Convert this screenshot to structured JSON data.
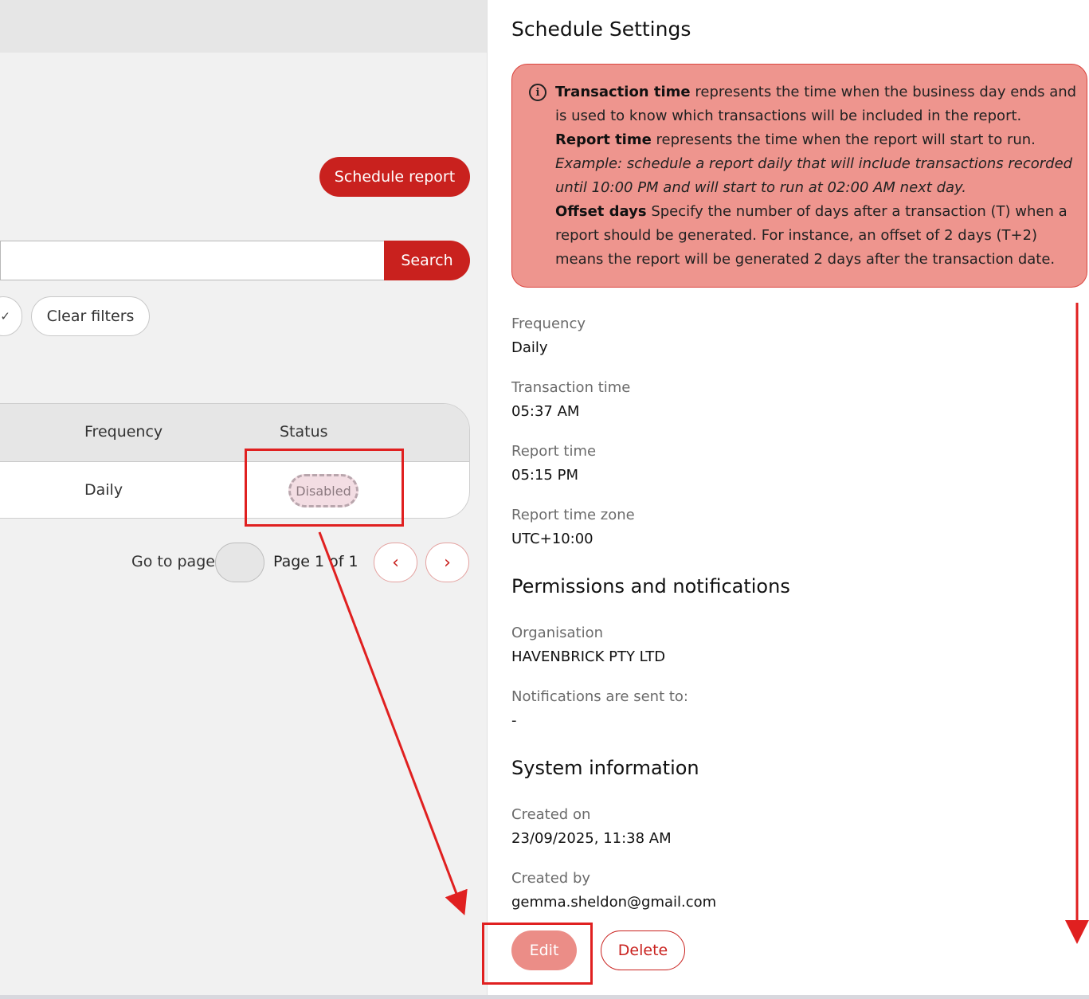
{
  "left": {
    "schedule_button": "Schedule report",
    "search_placeholder": "",
    "search_button": "Search",
    "check_icon": "✓",
    "clear_filters": "Clear filters",
    "table": {
      "headers": [
        "Frequency",
        "Status"
      ],
      "rows": [
        {
          "frequency": "Daily",
          "status": "Disabled"
        }
      ]
    },
    "pagination": {
      "goto_label": "Go to page",
      "page_label": "Page 1 of 1",
      "prev_icon": "‹",
      "next_icon": "›"
    }
  },
  "panel": {
    "title": "Schedule Settings",
    "info": {
      "icon": "info-circle-icon",
      "t1_bold": "Transaction time",
      "t1_text": " represents the time when the business day ends and is used to know which transactions will be included in the report.",
      "t2_bold": "Report time",
      "t2_text": " represents the time when the report will start to run.",
      "example": "Example: schedule a report daily that will include transactions recorded until 10:00 PM and will start to run at 02:00 AM next day.",
      "t3_bold": "Offset days",
      "t3_text": " Specify the number of days after a transaction (T) when a report should be generated. For instance, an offset of 2 days (T+2) means the report will be generated 2 days after the transaction date."
    },
    "fields": {
      "frequency_label": "Frequency",
      "frequency_value": "Daily",
      "transaction_time_label": "Transaction time",
      "transaction_time_value": "05:37 AM",
      "report_time_label": "Report time",
      "report_time_value": "05:15 PM",
      "report_tz_label": "Report time zone",
      "report_tz_value": "UTC+10:00"
    },
    "permissions": {
      "title": "Permissions and notifications",
      "org_label": "Organisation",
      "org_value": "HAVENBRICK PTY LTD",
      "notify_label": "Notifications are sent to:",
      "notify_value": "-"
    },
    "system": {
      "title": "System information",
      "created_on_label": "Created on",
      "created_on_value": "23/09/2025, 11:38 AM",
      "created_by_label": "Created by",
      "created_by_value": "gemma.sheldon@gmail.com"
    },
    "edit_button": "Edit",
    "delete_button": "Delete"
  },
  "colors": {
    "brand_red": "#c9211e",
    "info_bg": "#ee958e",
    "annotation_red": "#e02020"
  }
}
